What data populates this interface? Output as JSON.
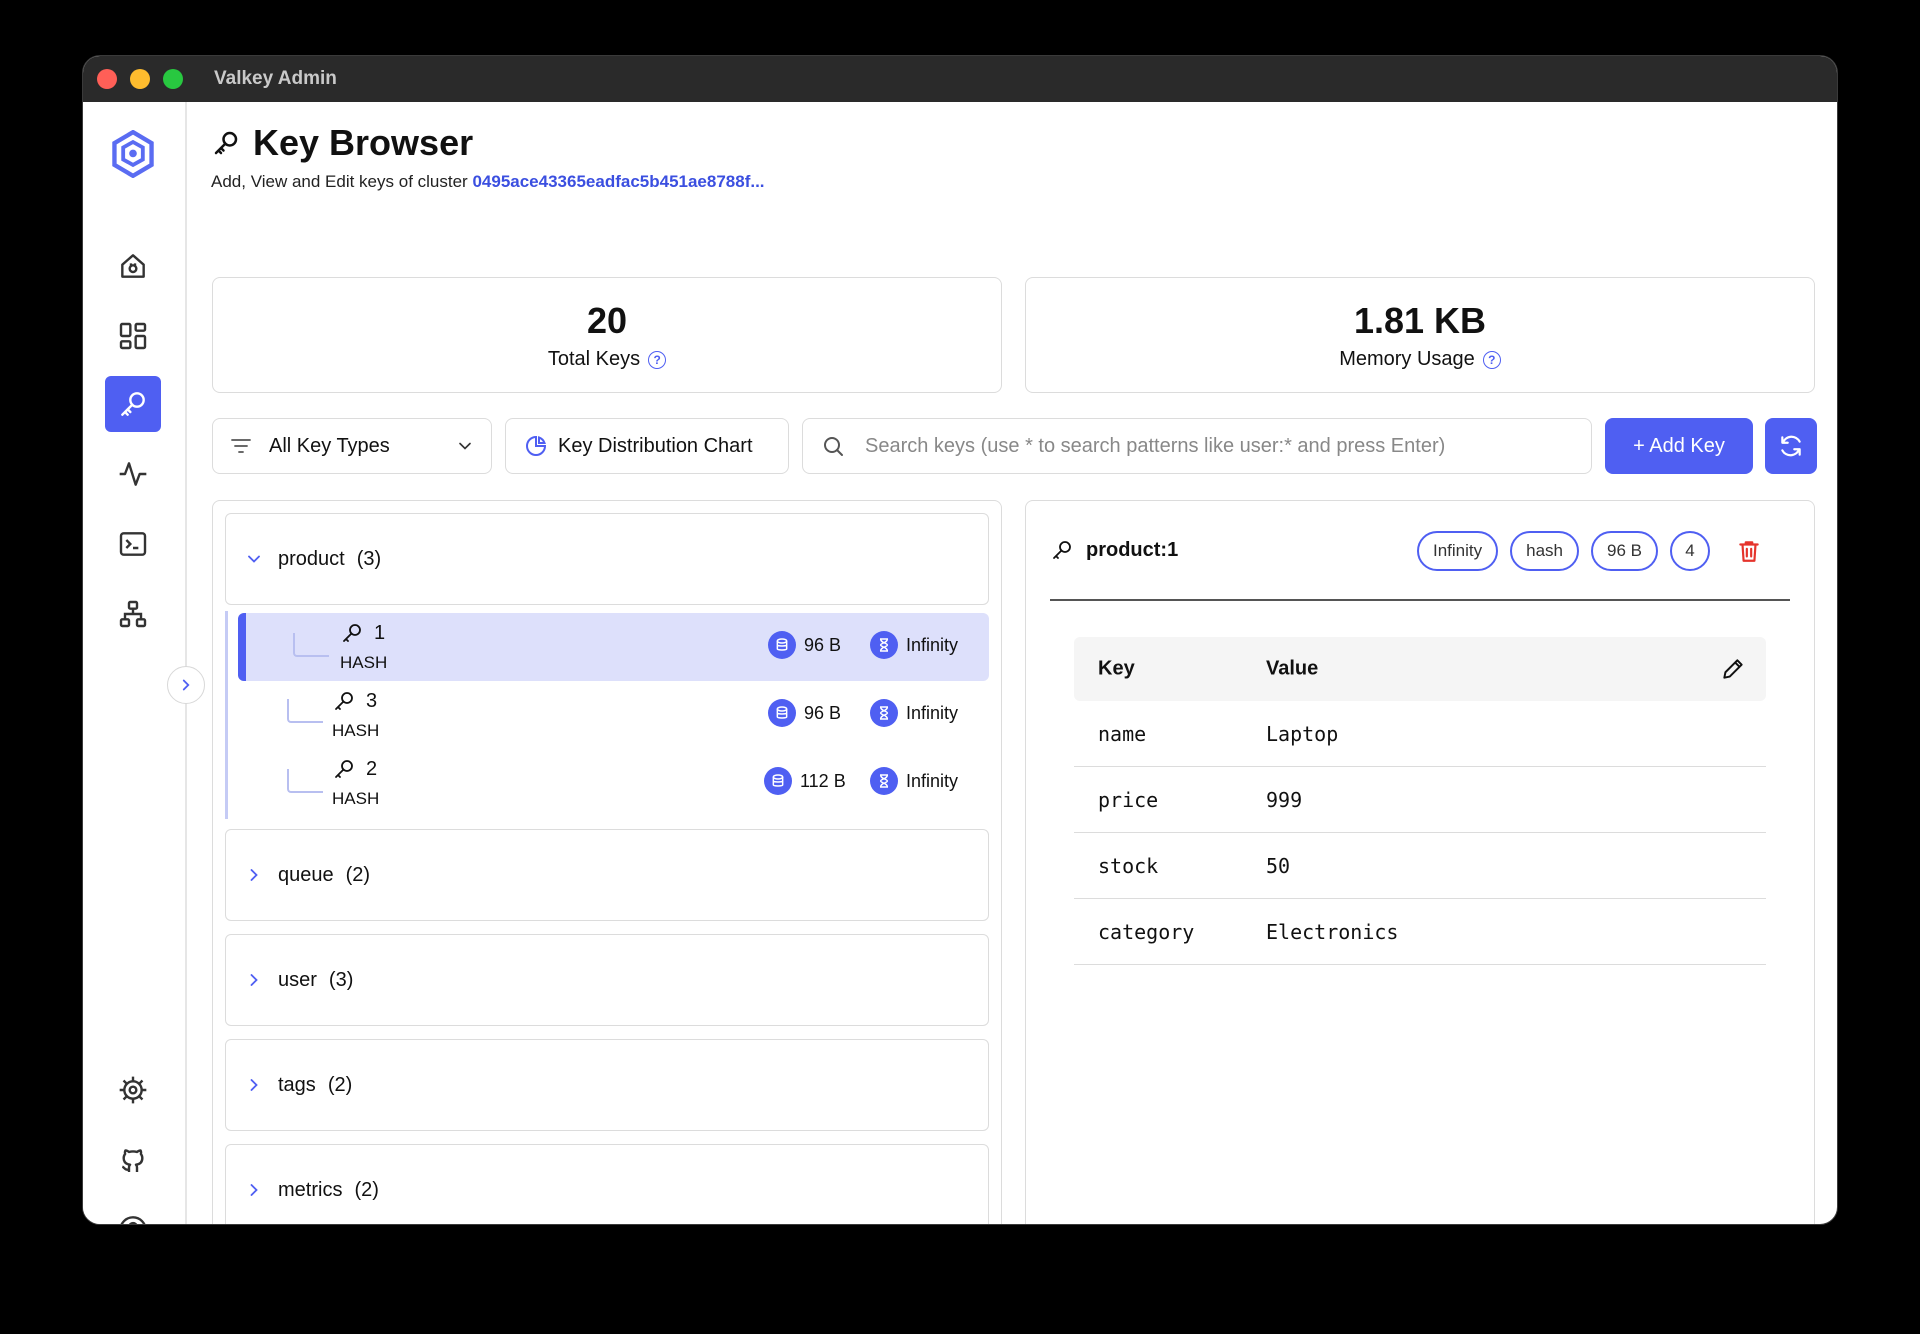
{
  "window": {
    "title": "Valkey Admin"
  },
  "header": {
    "title": "Key Browser",
    "subtitle_prefix": "Add, View and Edit keys of cluster",
    "cluster_id": "0495ace43365eadfac5b451ae8788f..."
  },
  "stats": {
    "total_keys": {
      "value": "20",
      "label": "Total Keys"
    },
    "memory": {
      "value": "1.81 KB",
      "label": "Memory Usage"
    }
  },
  "toolbar": {
    "filter_label": "All Key Types",
    "chart_label": "Key Distribution Chart",
    "search_placeholder": "Search keys (use * to search patterns like user:* and press Enter)",
    "add_label": "+ Add Key"
  },
  "groups": [
    {
      "name": "product",
      "count": "(3)",
      "expanded": true
    },
    {
      "name": "queue",
      "count": "(2)",
      "expanded": false
    },
    {
      "name": "user",
      "count": "(3)",
      "expanded": false
    },
    {
      "name": "tags",
      "count": "(2)",
      "expanded": false
    },
    {
      "name": "metrics",
      "count": "(2)",
      "expanded": false
    }
  ],
  "product_keys": [
    {
      "name": "1",
      "type": "HASH",
      "size": "96 B",
      "ttl": "Infinity",
      "selected": true
    },
    {
      "name": "3",
      "type": "HASH",
      "size": "96 B",
      "ttl": "Infinity",
      "selected": false
    },
    {
      "name": "2",
      "type": "HASH",
      "size": "112 B",
      "ttl": "Infinity",
      "selected": false
    }
  ],
  "detail": {
    "key": "product:1",
    "chips": {
      "ttl": "Infinity",
      "type": "hash",
      "size": "96 B",
      "fields": "4"
    },
    "columns": {
      "key": "Key",
      "value": "Value"
    },
    "rows": [
      {
        "key": "name",
        "value": "Laptop"
      },
      {
        "key": "price",
        "value": "999"
      },
      {
        "key": "stock",
        "value": "50"
      },
      {
        "key": "category",
        "value": "Electronics"
      }
    ]
  },
  "colors": {
    "accent": "#4f5ff2",
    "selected_row": "#dde0fb",
    "danger": "#e5342c"
  },
  "icons": [
    "valkey-logo-icon",
    "connection-icon",
    "dashboard-icon",
    "key-icon",
    "activity-icon",
    "terminal-icon",
    "cluster-topology-icon",
    "settings-icon",
    "github-icon",
    "help-icon",
    "chevron-right-icon"
  ]
}
